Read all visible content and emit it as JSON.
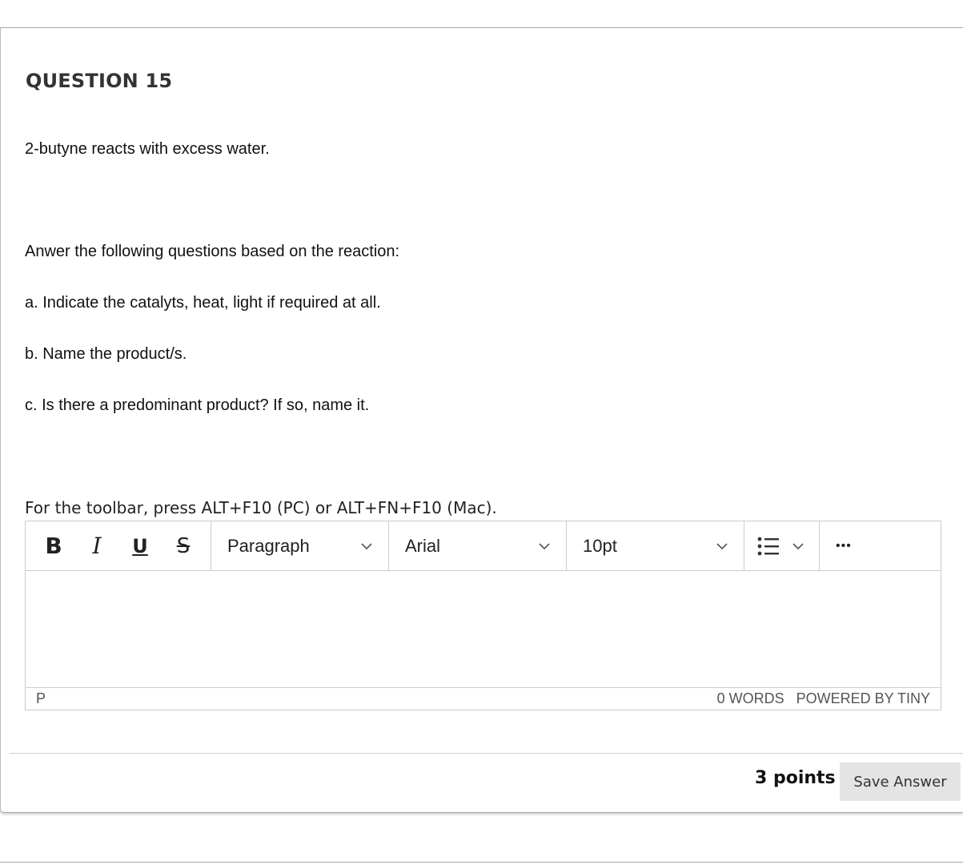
{
  "question": {
    "title": "QUESTION 15",
    "lines": [
      "2-butyne reacts with excess water.",
      "Anwer the following questions based on the reaction:",
      "a. Indicate the catalyts, heat, light if required at all.",
      "b. Name the product/s.",
      "c. Is there a predominant product? If so, name it."
    ]
  },
  "editor": {
    "hint": "For the toolbar, press ALT+F10 (PC) or ALT+FN+F10 (Mac).",
    "bold_label": "B",
    "italic_label": "I",
    "underline_label": "U",
    "strike_label": "S",
    "block_format": "Paragraph",
    "font_family": "Arial",
    "font_size": "10pt",
    "more_label": "•••",
    "status_path": "P",
    "word_count": "0 WORDS",
    "powered_by": "POWERED BY TINY"
  },
  "footer": {
    "points": "3 points",
    "save_label": "Save Answer"
  },
  "colors": {
    "border": "#cccccc",
    "save_bg": "#e4e4e4",
    "text": "#1a1a1a"
  }
}
